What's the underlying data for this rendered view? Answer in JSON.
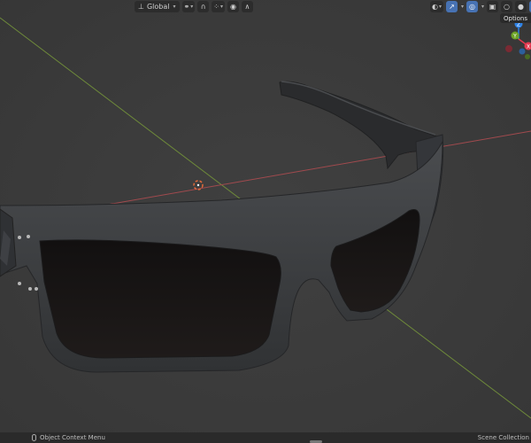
{
  "header": {
    "orientation_label": "Global",
    "options_label": "Options"
  },
  "status": {
    "context_menu_label": "Object Context Menu",
    "collection_label": "Scene Collection"
  },
  "gizmo": {
    "x_label": "X",
    "y_label": "Y",
    "z_label": "Z",
    "x_color": "#e53950",
    "y_color": "#6ea427",
    "z_color": "#2e82e6"
  },
  "icons": {
    "orientation": "orientation-axis-icon",
    "pivot": "pivot-icon",
    "snap": "magnet-icon",
    "snap_grid": "grid-snap-icon",
    "proportional": "proportional-edit-icon",
    "falloff": "falloff-curve-icon",
    "visibility": "eye-icon",
    "gizmo_toggle": "gizmo-arrow-icon",
    "overlays": "overlay-icon",
    "xray": "xray-icon",
    "shading_wire": "wireframe-shading-icon",
    "shading_solid": "solid-shading-icon",
    "shading_material": "material-shading-icon",
    "shading_rendered": "rendered-shading-icon",
    "cursor": "3d-cursor-icon"
  }
}
